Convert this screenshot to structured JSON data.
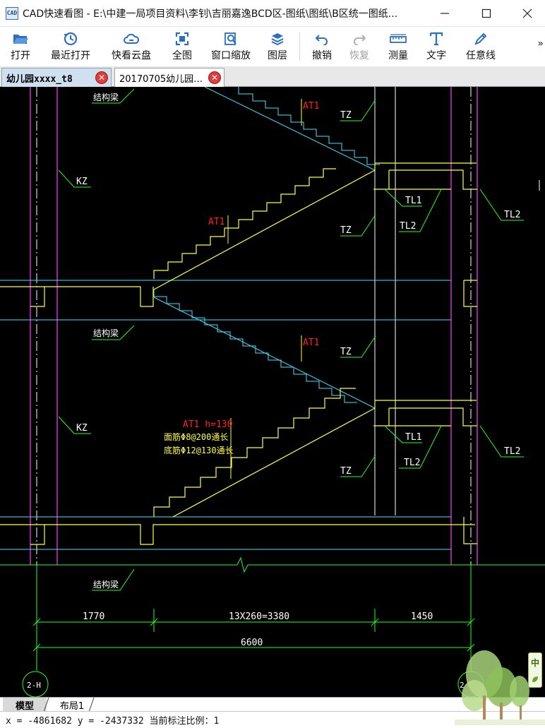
{
  "window": {
    "app_icon_label": "CAD",
    "title": "CAD快速看图 - E:\\中建一局项目资料\\李钊\\吉丽嘉逸BCD区-图纸\\图纸\\B区统一图纸..."
  },
  "toolbar": {
    "items": [
      {
        "label": "打开",
        "icon": "folder-open-icon",
        "enabled": true
      },
      {
        "label": "最近打开",
        "icon": "history-clock-icon",
        "enabled": true
      },
      {
        "label": "快看云盘",
        "icon": "cloud-icon",
        "enabled": true
      },
      {
        "label": "全图",
        "icon": "fit-extents-icon",
        "enabled": true
      },
      {
        "label": "窗口缩放",
        "icon": "zoom-window-icon",
        "enabled": true
      },
      {
        "label": "图层",
        "icon": "layers-icon",
        "enabled": true
      },
      {
        "label": "撤销",
        "icon": "undo-icon",
        "enabled": true
      },
      {
        "label": "恢复",
        "icon": "redo-icon",
        "enabled": false
      },
      {
        "label": "测量",
        "icon": "ruler-icon",
        "enabled": true
      },
      {
        "label": "文字",
        "icon": "text-t-icon",
        "enabled": true
      },
      {
        "label": "任意线",
        "icon": "pencil-icon",
        "enabled": true
      }
    ],
    "more_label": "»"
  },
  "tabs": [
    {
      "label": "幼儿园xxxx_t8",
      "active": true
    },
    {
      "label": "20170705幼儿园…",
      "active": false
    }
  ],
  "drawing": {
    "labels": {
      "structural_beam": "结构梁",
      "kz": "KZ",
      "tz": "TZ",
      "tl1": "TL1",
      "tl2": "TL2",
      "at1": "AT1",
      "at1_detail": "AT1 h=130",
      "rebar_top": "面筋Φ8@200通长",
      "rebar_bottom": "底筋Φ12@130通长"
    },
    "dimensions": {
      "left": "1770",
      "middle": "13X260=3380",
      "right": "1450",
      "total": "6600"
    },
    "axis_labels": {
      "left": "2-H",
      "right": "2"
    },
    "colors": {
      "background": "#000000",
      "wall": "#ff40ff",
      "stair_slab": "#ffff40",
      "stair_cyan": "#40e0ff",
      "dimension": "#20ff20",
      "red_label": "#ff2020",
      "white_line": "#ffffff"
    }
  },
  "layout_tabs": [
    {
      "label": "模型",
      "active": true
    },
    {
      "label": "布局1",
      "active": false
    }
  ],
  "status": {
    "text": "x = -4861682 y = -2437332 当前标注比例：1"
  },
  "ime": {
    "char": "中"
  }
}
